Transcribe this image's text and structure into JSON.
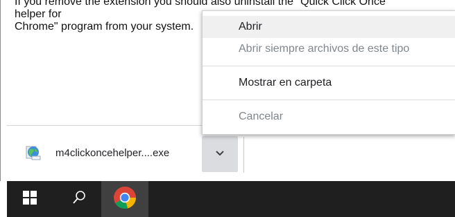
{
  "page": {
    "text": "If you remove the extension you should also uninstall the \"Quick Click Once helper for\nChrome\" program from your system."
  },
  "download_shelf": {
    "file_name": "m4clickoncehelper....exe"
  },
  "context_menu": {
    "items": [
      {
        "label": "Abrir",
        "state": "hovered"
      },
      {
        "label": "Abrir siempre archivos de este tipo",
        "state": "disabled"
      },
      {
        "label": "Mostrar en carpeta",
        "state": "normal"
      },
      {
        "label": "Cancelar",
        "state": "disabled"
      }
    ]
  },
  "taskbar": {
    "icons": [
      "windows-start-icon",
      "search-icon",
      "chrome-icon"
    ]
  },
  "colors": {
    "menu_hover": "#f0f0f0",
    "disabled_text": "#80868b",
    "taskbar_bg": "#1f1f1f",
    "active_task": "#404040"
  }
}
